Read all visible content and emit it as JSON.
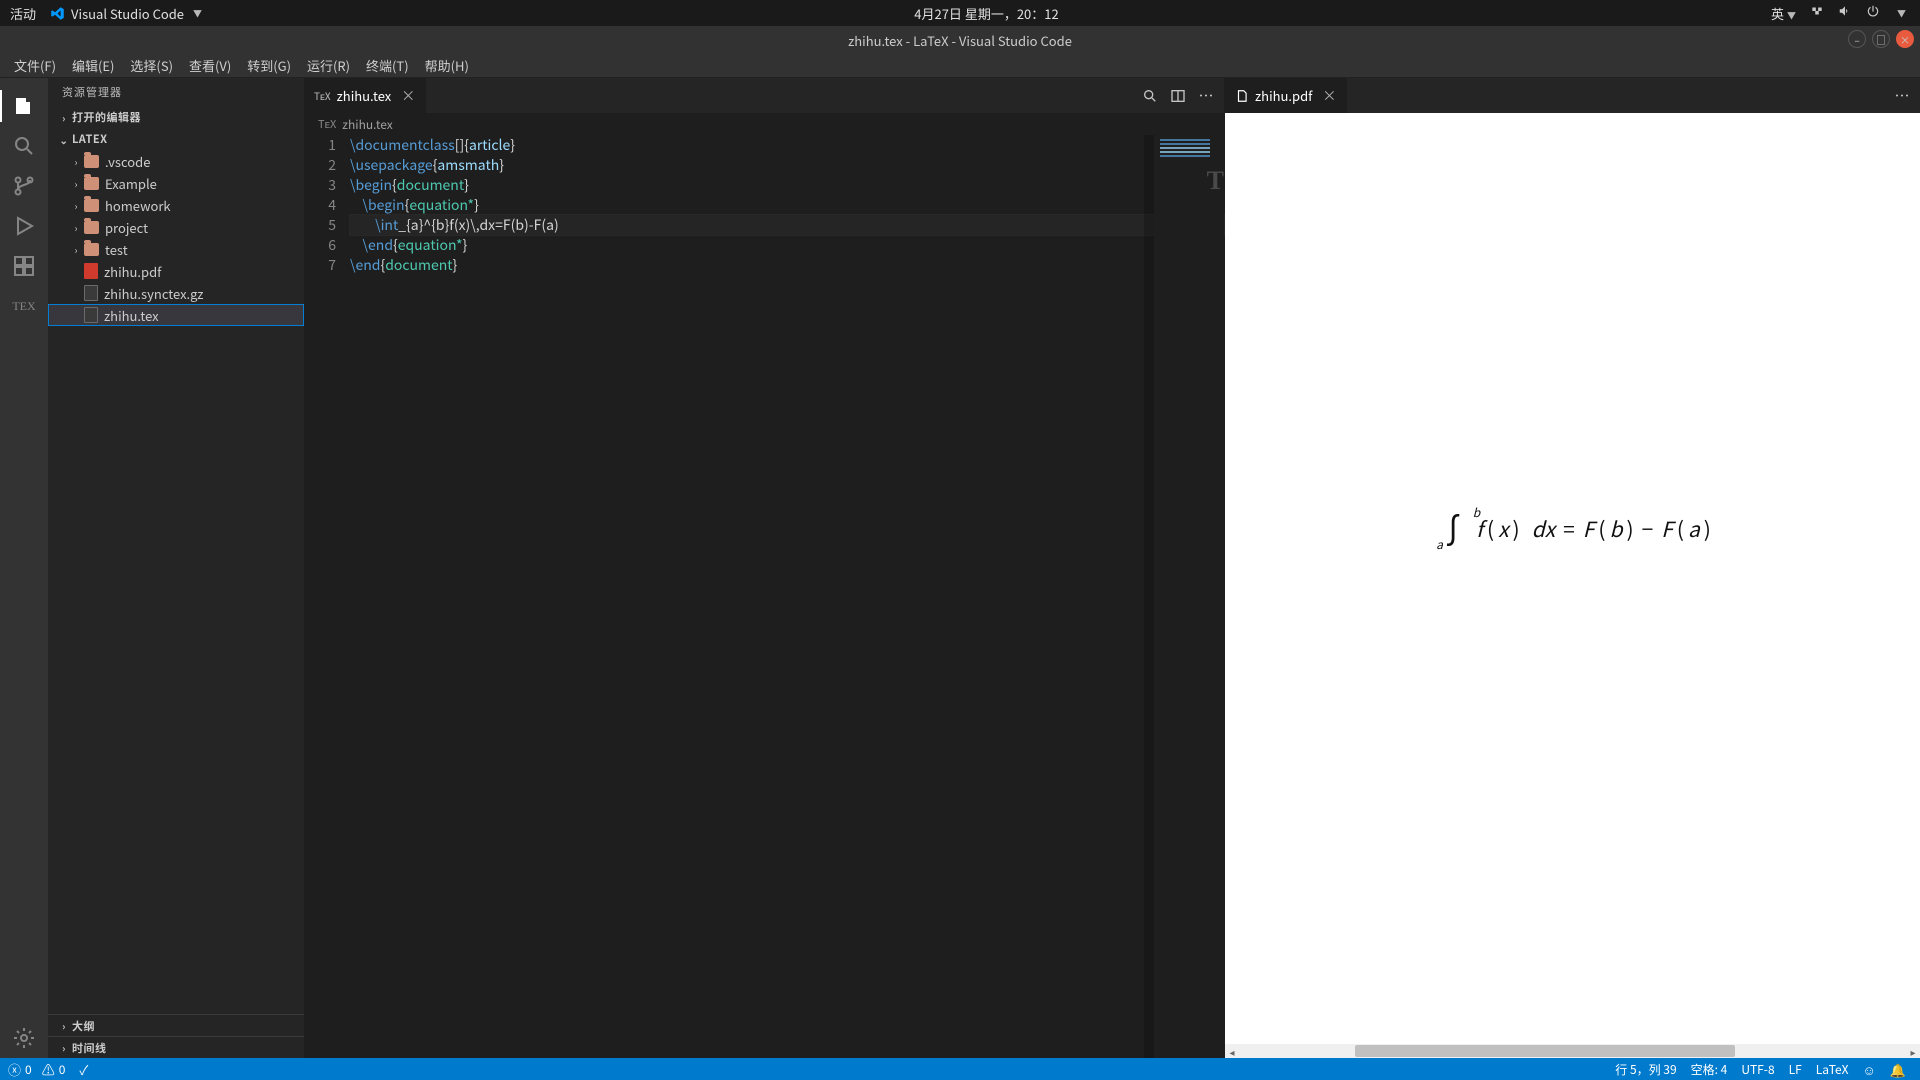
{
  "os_bar": {
    "activities": "活动",
    "app_name": "Visual Studio Code",
    "clock": "4月27日 星期一，20：12",
    "ime": "英"
  },
  "title_bar": {
    "title": "zhihu.tex - LaTeX - Visual Studio Code"
  },
  "menu": {
    "file": "文件(F)",
    "edit": "编辑(E)",
    "select": "选择(S)",
    "view": "查看(V)",
    "go": "转到(G)",
    "run": "运行(R)",
    "terminal": "终端(T)",
    "help": "帮助(H)"
  },
  "activity_bar": {
    "explorer": "files-icon",
    "search": "search-icon",
    "scm": "git-branch-icon",
    "debug": "play-bug-icon",
    "extensions": "extensions-icon",
    "tex": "TEX",
    "settings": "gear-icon"
  },
  "explorer": {
    "panel_title": "资源管理器",
    "sections": {
      "open_editors": "打开的编辑器",
      "workspace_name": "LATEX",
      "outline": "大纲",
      "timeline": "时间线"
    },
    "tree": [
      {
        "name": ".vscode",
        "type": "folder"
      },
      {
        "name": "Example",
        "type": "folder"
      },
      {
        "name": "homework",
        "type": "folder"
      },
      {
        "name": "project",
        "type": "folder"
      },
      {
        "name": "test",
        "type": "folder"
      },
      {
        "name": "zhihu.pdf",
        "type": "pdf"
      },
      {
        "name": "zhihu.synctex.gz",
        "type": "file"
      },
      {
        "name": "zhihu.tex",
        "type": "file",
        "selected": true
      }
    ]
  },
  "editor": {
    "tab_name": "zhihu.tex",
    "breadcrumb": "zhihu.tex",
    "lines": [
      [
        {
          "c": "k",
          "t": "\\documentclass"
        },
        {
          "c": "pun",
          "t": "[]"
        },
        {
          "c": "pun",
          "t": "{"
        },
        {
          "c": "id",
          "t": "article"
        },
        {
          "c": "pun",
          "t": "}"
        }
      ],
      [
        {
          "c": "k",
          "t": "\\usepackage"
        },
        {
          "c": "pun",
          "t": "{"
        },
        {
          "c": "id",
          "t": "amsmath"
        },
        {
          "c": "pun",
          "t": "}"
        }
      ],
      [
        {
          "c": "k",
          "t": "\\begin"
        },
        {
          "c": "pun",
          "t": "{"
        },
        {
          "c": "id2",
          "t": "document"
        },
        {
          "c": "pun",
          "t": "}"
        }
      ],
      [
        {
          "c": "pun",
          "t": "    "
        },
        {
          "c": "k",
          "t": "\\begin"
        },
        {
          "c": "pun",
          "t": "{"
        },
        {
          "c": "id2",
          "t": "equation*"
        },
        {
          "c": "pun",
          "t": "}"
        }
      ],
      [
        {
          "c": "pun",
          "t": "        "
        },
        {
          "c": "int",
          "t": "\\int"
        },
        {
          "c": "pun",
          "t": "_{a}^{b}f(x)\\,dx=F(b)-F(a)"
        }
      ],
      [
        {
          "c": "pun",
          "t": "    "
        },
        {
          "c": "k",
          "t": "\\end"
        },
        {
          "c": "pun",
          "t": "{"
        },
        {
          "c": "id2",
          "t": "equation*"
        },
        {
          "c": "pun",
          "t": "}"
        }
      ],
      [
        {
          "c": "k",
          "t": "\\end"
        },
        {
          "c": "pun",
          "t": "{"
        },
        {
          "c": "id2",
          "t": "document"
        },
        {
          "c": "pun",
          "t": "}"
        }
      ]
    ],
    "current_line_index": 4
  },
  "preview": {
    "tab_name": "zhihu.pdf",
    "integral_sup": "b",
    "integral_sub": "a",
    "tex_f": "f",
    "tex_x": "x",
    "tex_dx": "dx",
    "tex_eq": "=",
    "tex_Fb": "F",
    "tex_b": "b",
    "tex_minus": "−",
    "tex_Fa": "F",
    "tex_a": "a"
  },
  "status": {
    "errors": "0",
    "warnings": "0",
    "cursor": "行 5，列 39",
    "spaces": "空格: 4",
    "encoding": "UTF-8",
    "eol": "LF",
    "lang": "LaTeX"
  },
  "chart_data": null
}
